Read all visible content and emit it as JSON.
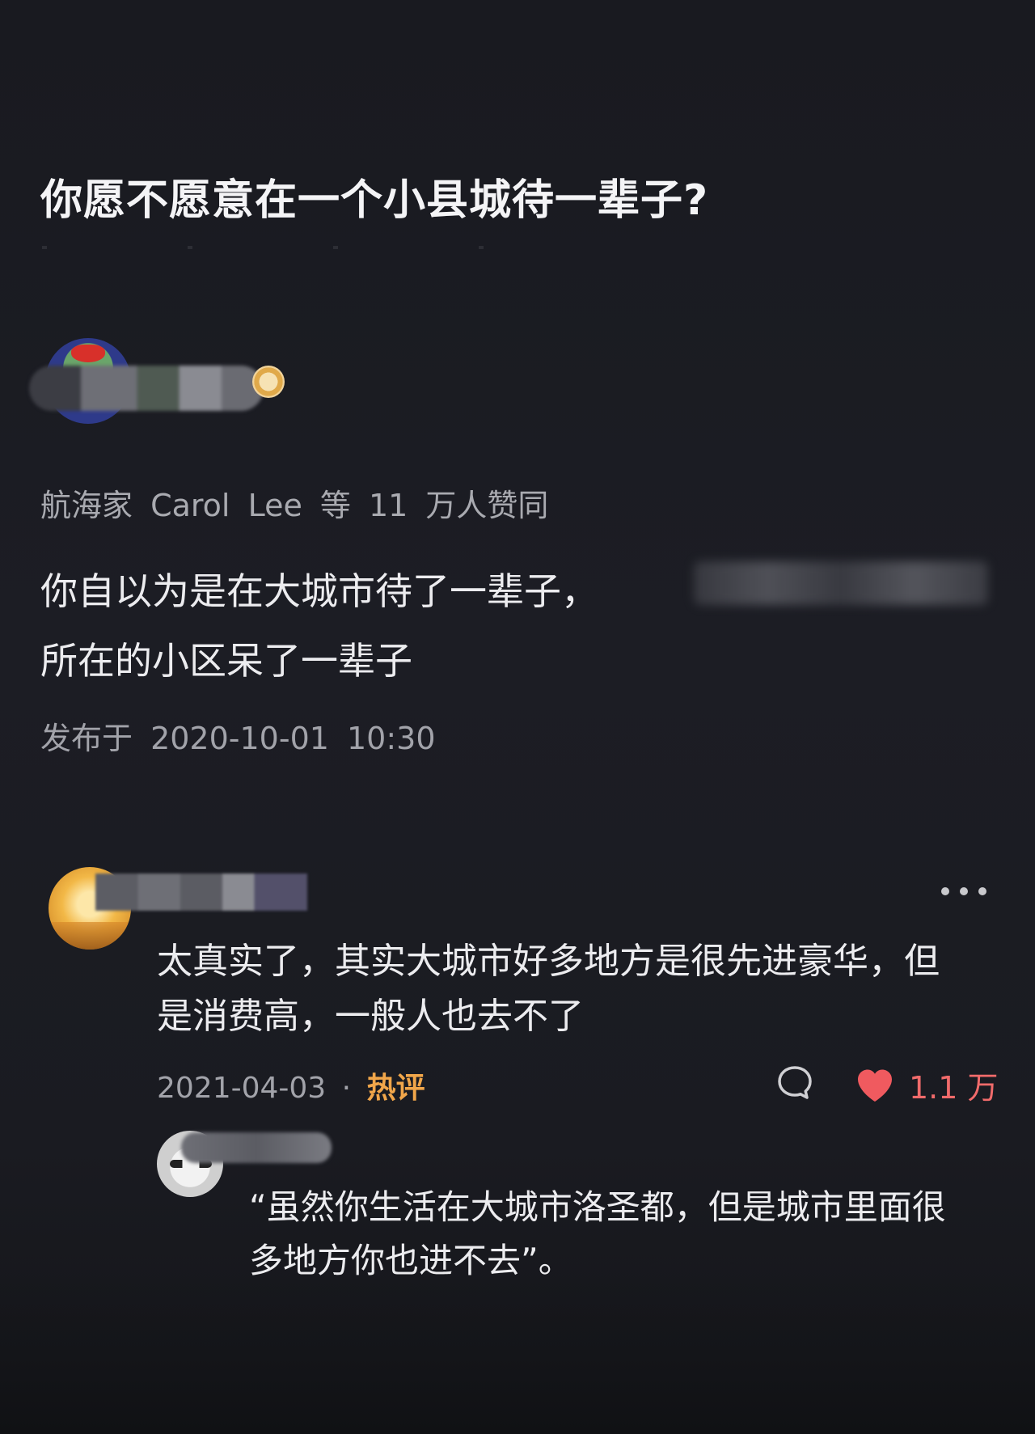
{
  "question": {
    "title": "你愿不愿意在一个小县城待一辈子?"
  },
  "answer": {
    "approval_text": "航海家 Carol Lee 等 11 万人赞同",
    "body_lines": [
      "你自以为是在大城市待了一辈子，",
      "所在的小区呆了一辈子"
    ],
    "published": "发布于 2020-10-01 10:30"
  },
  "comment": {
    "body_lines": [
      "太真实了，其实大城市好多地方是很先进豪华，但",
      "是消费高，一般人也去不了"
    ],
    "date": "2021-04-03",
    "separator": "·",
    "hot_label": "热评",
    "like_count": "1.1 万",
    "accent_hot": "#f1a64a",
    "accent_like": "#f16b6b"
  },
  "reply": {
    "body_lines": [
      "“虽然你生活在大城市洛圣都，但是城市里面很",
      "多地方你也进不去”。"
    ]
  },
  "icons": {
    "more": "more-dots-icon",
    "reply": "comment-bubble-icon",
    "like": "heart-icon"
  }
}
